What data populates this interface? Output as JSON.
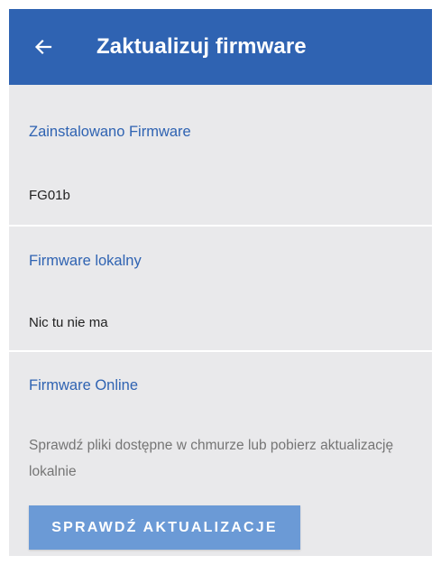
{
  "header": {
    "title": "Zaktualizuj firmware",
    "back_icon": "arrow-left-icon"
  },
  "colors": {
    "app_bar": "#2f63b2",
    "accent": "#2f63b2",
    "background": "#e9e9eb",
    "button": "#6b9ad6"
  },
  "installed": {
    "label": "Zainstalowano Firmware",
    "value": "FG01b"
  },
  "local": {
    "label": "Firmware lokalny",
    "value": "Nic tu nie ma"
  },
  "online": {
    "label": "Firmware Online",
    "description": "Sprawdź pliki dostępne w chmurze lub pobierz aktualizację lokalnie",
    "button_label": "SPRAWDŹ AKTUALIZACJE"
  }
}
